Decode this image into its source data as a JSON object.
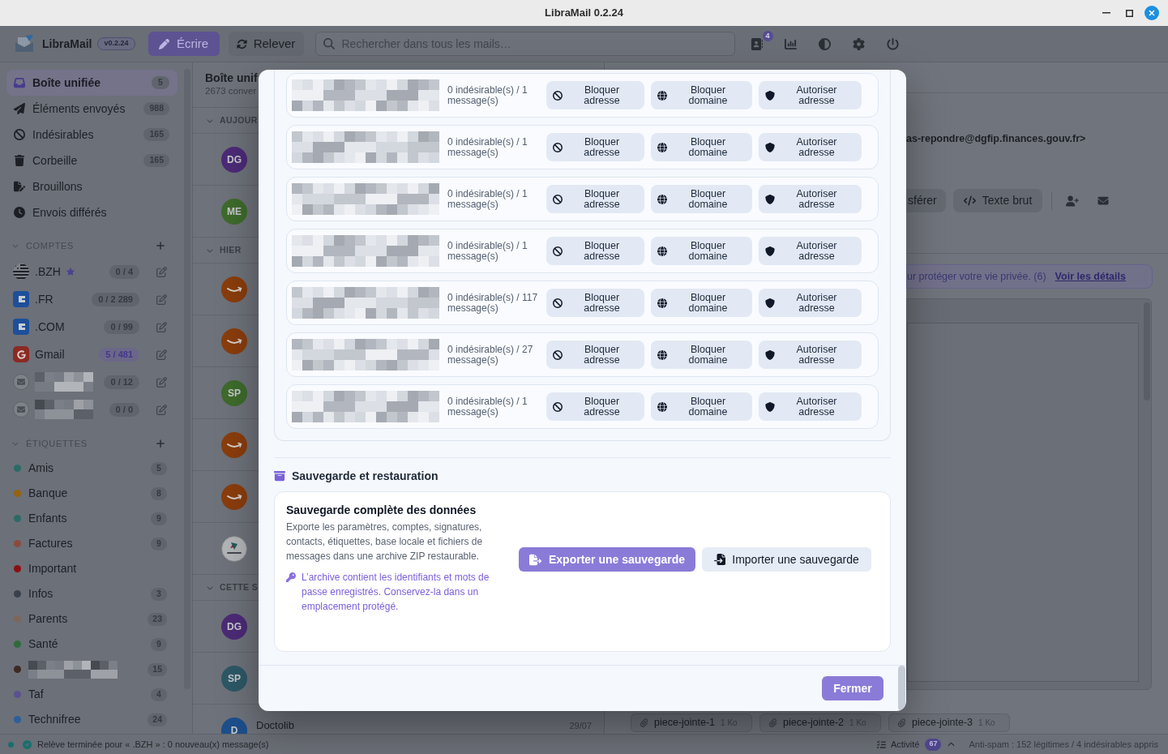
{
  "window": {
    "title": "LibraMail 0.2.24"
  },
  "toolbar": {
    "app_name": "LibraMail",
    "version": "v0.2.24",
    "compose": "Écrire",
    "fetch": "Relever",
    "search": {
      "placeholder": "Rechercher dans tous les mails…"
    },
    "notification_count": "4"
  },
  "sidebar": {
    "folders": [
      {
        "kind": "inbox",
        "label": "Boîte unifiée",
        "count": "5",
        "selected": true
      },
      {
        "kind": "sent",
        "label": "Éléments envoyés",
        "count": "988",
        "selected": false
      },
      {
        "kind": "spam",
        "label": "Indésirables",
        "count": "165",
        "selected": false
      },
      {
        "kind": "trash",
        "label": "Corbeille",
        "count": "165",
        "selected": false
      },
      {
        "kind": "drafts",
        "label": "Brouillons",
        "selected": false
      },
      {
        "kind": "scheduled",
        "label": "Envois différés",
        "selected": false
      }
    ],
    "accounts": {
      "header": "COMPTES",
      "expanded": true,
      "items": [
        {
          "kind": "flag",
          "name": ".BZH",
          "pixelated": false,
          "starred": true,
          "count": "0 / 4",
          "unread": false
        },
        {
          "kind": "provider",
          "name": ".FR",
          "pixelated": false,
          "starred": false,
          "count": "0 / 2 289",
          "unread": false
        },
        {
          "kind": "provider",
          "name": ".COM",
          "pixelated": false,
          "starred": false,
          "count": "0 / 99",
          "unread": false
        },
        {
          "kind": "gmail",
          "name": "Gmail",
          "pixelated": false,
          "starred": false,
          "count": "5 / 481",
          "unread": true
        },
        {
          "kind": "generic",
          "pixelated": true,
          "starred": false,
          "count": "0 / 12",
          "unread": false
        },
        {
          "kind": "generic",
          "pixelated": true,
          "starred": false,
          "count": "0 / 0",
          "unread": false
        }
      ]
    },
    "labels": {
      "header": "ÉTIQUETTES",
      "expanded": true,
      "items": [
        {
          "name": "Amis",
          "pixelated": false,
          "count": "5",
          "color": "#2a6b66"
        },
        {
          "name": "Banque",
          "pixelated": false,
          "count": "8",
          "color": "#94630f"
        },
        {
          "name": "Enfants",
          "pixelated": false,
          "count": "9",
          "color": "#2a6b66"
        },
        {
          "name": "Factures",
          "pixelated": false,
          "count": "9",
          "color": "#8a4b3c"
        },
        {
          "name": "Important",
          "pixelated": false,
          "color": "#8a1010"
        },
        {
          "name": "Infos",
          "pixelated": false,
          "count": "3",
          "color": "#3a404c"
        },
        {
          "name": "Parents",
          "pixelated": false,
          "count": "23",
          "color": "#7c675c"
        },
        {
          "name": "Santé",
          "pixelated": false,
          "count": "9",
          "color": "#2e6b3c"
        },
        {
          "pixelated": true,
          "count": "15",
          "color": "#3b2a22"
        },
        {
          "name": "Taf",
          "pixelated": false,
          "count": "4",
          "color": "#5b5190"
        },
        {
          "name": "Technifree",
          "pixelated": false,
          "count": "24",
          "color": "#2c5f9a"
        }
      ]
    }
  },
  "message_list": {
    "title": "Boîte unif",
    "subtitle": "2673 conver",
    "groups": [
      {
        "label": "AUJOUR",
        "expanded": true,
        "messages": [
          {
            "kind": "initials",
            "initials": "DG",
            "color": "#4c2b77"
          },
          {
            "kind": "initials",
            "initials": "ME",
            "color": "#3e6b2c"
          }
        ]
      },
      {
        "label": "HIER",
        "expanded": true,
        "messages": [
          {
            "kind": "smile",
            "color": "#8a3d0c"
          },
          {
            "kind": "smile",
            "color": "#8a3d0c"
          },
          {
            "kind": "initials",
            "initials": "SP",
            "color": "#3e6b2c"
          },
          {
            "kind": "smile",
            "color": "#8a3d0c"
          },
          {
            "kind": "smile",
            "color": "#8a3d0c"
          },
          {
            "kind": "logo"
          }
        ]
      },
      {
        "label": "CETTE S",
        "expanded": true,
        "messages": [
          {
            "kind": "initials",
            "initials": "DG",
            "color": "#4c2b77"
          },
          {
            "kind": "initials",
            "initials": "SP",
            "color": "#2d5866"
          },
          {
            "kind": "initials",
            "initials": "D",
            "color": "#1d4f8c",
            "sender": "Doctolib",
            "date": "29/07"
          }
        ]
      }
    ]
  },
  "reading_pane": {
    "from": "as-repondre@dgfip.finances.gouv.fr>",
    "actions": [
      {
        "kind": "plain",
        "label": "sférer"
      },
      {
        "kind": "code",
        "label": "Texte brut"
      }
    ],
    "privacy_banner": {
      "text": "ur protéger votre vie privée. (6)",
      "link": "Voir les détails"
    },
    "attachments": [
      {
        "name": "piece-jointe-1",
        "size": "1 Ko"
      },
      {
        "name": "piece-jointe-2",
        "size": "1 Ko"
      },
      {
        "name": "piece-jointe-3",
        "size": "1 Ko"
      }
    ]
  },
  "dialog": {
    "senders": [
      {
        "stats": "0 indésirable(s) / 1 message(s)",
        "actions": [
          {
            "kind": "block_address",
            "label": "Bloquer adresse"
          },
          {
            "kind": "block_domain",
            "label": "Bloquer domaine"
          },
          {
            "kind": "allow_address",
            "label": "Autoriser adresse"
          }
        ]
      },
      {
        "stats": "0 indésirable(s) / 1 message(s)",
        "actions": [
          {
            "kind": "block_address",
            "label": "Bloquer adresse"
          },
          {
            "kind": "block_domain",
            "label": "Bloquer domaine"
          },
          {
            "kind": "allow_address",
            "label": "Autoriser adresse"
          }
        ]
      },
      {
        "stats": "0 indésirable(s) / 1 message(s)",
        "actions": [
          {
            "kind": "block_address",
            "label": "Bloquer adresse"
          },
          {
            "kind": "block_domain",
            "label": "Bloquer domaine"
          },
          {
            "kind": "allow_address",
            "label": "Autoriser adresse"
          }
        ]
      },
      {
        "stats": "0 indésirable(s) / 1 message(s)",
        "actions": [
          {
            "kind": "block_address",
            "label": "Bloquer adresse"
          },
          {
            "kind": "block_domain",
            "label": "Bloquer domaine"
          },
          {
            "kind": "allow_address",
            "label": "Autoriser adresse"
          }
        ]
      },
      {
        "stats": "0 indésirable(s) / 117 message(s)",
        "actions": [
          {
            "kind": "block_address",
            "label": "Bloquer adresse"
          },
          {
            "kind": "block_domain",
            "label": "Bloquer domaine"
          },
          {
            "kind": "allow_address",
            "label": "Autoriser adresse"
          }
        ]
      },
      {
        "stats": "0 indésirable(s) / 27 message(s)",
        "actions": [
          {
            "kind": "block_address",
            "label": "Bloquer adresse"
          },
          {
            "kind": "block_domain",
            "label": "Bloquer domaine"
          },
          {
            "kind": "allow_address",
            "label": "Autoriser adresse"
          }
        ]
      },
      {
        "stats": "0 indésirable(s) / 1 message(s)",
        "actions": [
          {
            "kind": "block_address",
            "label": "Bloquer adresse"
          },
          {
            "kind": "block_domain",
            "label": "Bloquer domaine"
          },
          {
            "kind": "allow_address",
            "label": "Autoriser adresse"
          }
        ]
      }
    ],
    "backup": {
      "heading": "Sauvegarde et restauration",
      "title": "Sauvegarde complète des données",
      "description": "Exporte les paramètres, comptes, signatures, contacts, étiquettes, base locale et fichiers de messages dans une archive ZIP restaurable.",
      "warning": "L’archive contient les identifiants et mots de passe enregistrés. Conservez-la dans un emplacement protégé.",
      "export": "Exporter une sauvegarde",
      "import": "Importer une sauvegarde"
    },
    "close": "Fermer"
  },
  "status_bar": {
    "message": "Relève terminée pour « .BZH » : 0 nouveau(x) message(s)",
    "activity": "Activité",
    "activity_count": "67",
    "antispam": "Anti-spam : 152 légitimes / 4 indésirables appris"
  }
}
